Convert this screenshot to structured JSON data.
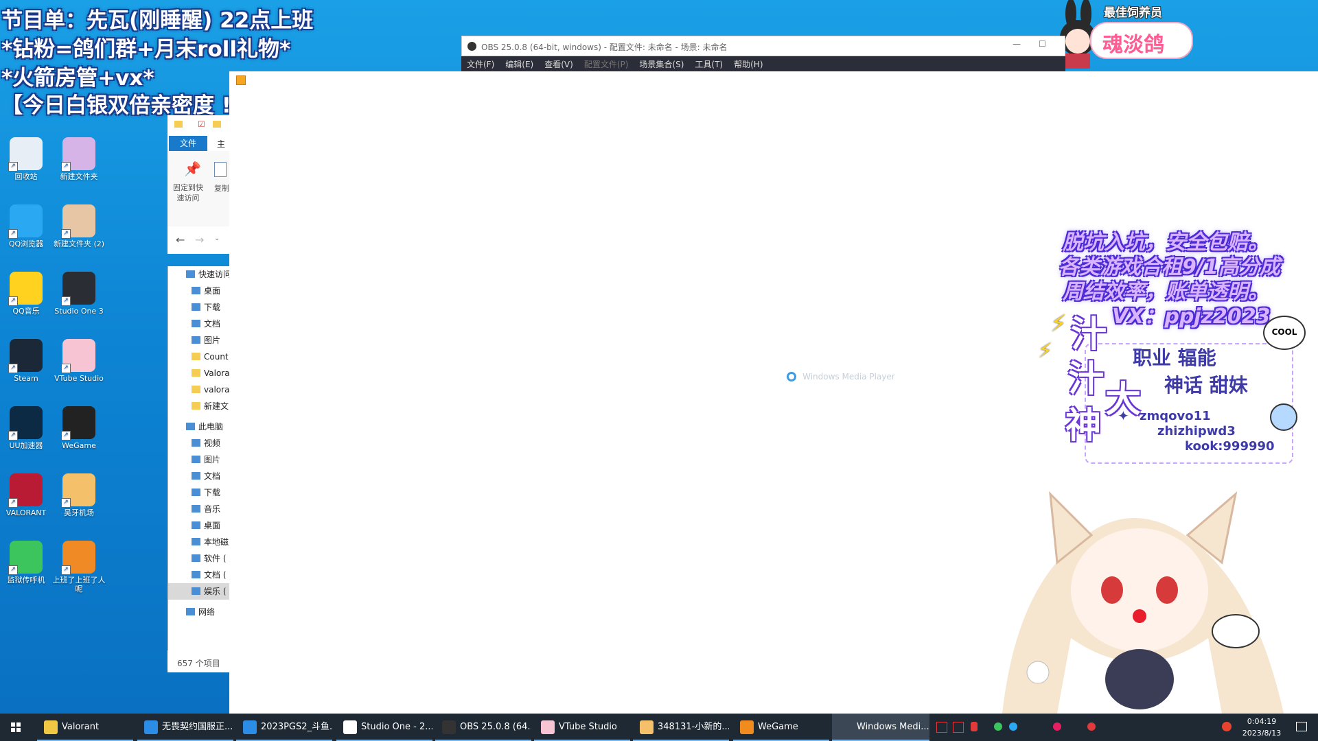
{
  "overlay": {
    "line1": "节目单：先瓦(刚睡醒) 22点上班",
    "line2": "*钻粉=鸽们群+月末roll礼物*",
    "line3": "*火箭房管+vx*",
    "line4": "【今日白银双倍亲密度 !!! 】"
  },
  "badge": {
    "title": "最佳饲养员",
    "name": "魂淡鸽"
  },
  "desktop_icons": [
    {
      "label": "回收站",
      "color": "#e8eef5"
    },
    {
      "label": "新建文件夹",
      "color": "#d6b4e8"
    },
    {
      "label": "QQ浏览器",
      "color": "#2aa8f2"
    },
    {
      "label": "新建文件夹 (2)",
      "color": "#e7c6a5"
    },
    {
      "label": "QQ音乐",
      "color": "#ffd21f"
    },
    {
      "label": "Studio One 3",
      "color": "#2a2d33"
    },
    {
      "label": "Steam",
      "color": "#1b2838"
    },
    {
      "label": "VTube Studio",
      "color": "#f7c4d4"
    },
    {
      "label": "UU加速器",
      "color": "#0d2a44"
    },
    {
      "label": "WeGame",
      "color": "#222"
    },
    {
      "label": "VALORANT",
      "color": "#b81b33"
    },
    {
      "label": "吴牙机场",
      "color": "#f4c06a"
    },
    {
      "label": "监狱传呼机",
      "color": "#3cc55d"
    },
    {
      "label": "上班了上班了人呢",
      "color": "#f08a24"
    }
  ],
  "obs": {
    "title": "OBS 25.0.8 (64-bit, windows) - 配置文件: 未命名 - 场景: 未命名",
    "menu": [
      "文件(F)",
      "编辑(E)",
      "查看(V)",
      "配置文件(P)",
      "场景集合(S)",
      "工具(T)",
      "帮助(H)"
    ]
  },
  "explorer": {
    "tab_file": "文件",
    "tab_home": "主页",
    "pin_label": "固定到快速访问",
    "copy_label": "复制",
    "nav_items": [
      "快速访问",
      "桌面",
      "下载",
      "文档",
      "图片",
      "Count",
      "Valora",
      "valora",
      "新建文",
      "此电脑",
      "视频",
      "图片",
      "文档",
      "下载",
      "音乐",
      "桌面",
      "本地磁",
      "软件 (",
      "文档 (",
      "娱乐 (",
      "网络"
    ],
    "item_count": "657 个项目"
  },
  "wmp": {
    "loading_text": "Windows Media Player"
  },
  "promo": {
    "line1": "脱坑入坑，安全包赔。",
    "line2": "各类游戏合租9/1高分成",
    "line3": "周结效率，账单透明。",
    "line4": "VX：ppjz2023",
    "chars": [
      "汁",
      "汁",
      "大",
      "神"
    ],
    "role1": "职业 辐能",
    "role2": "神话 甜妹",
    "cool": "COOL",
    "id1": "zmqovo11",
    "id2": "zhizhipwd3",
    "id3": "kook:999990"
  },
  "taskbar": {
    "items": [
      {
        "label": "Valorant",
        "color": "#f2c744"
      },
      {
        "label": "无畏契约国服正...",
        "color": "#2b8de6"
      },
      {
        "label": "2023PGS2_斗鱼...",
        "color": "#2b8de6"
      },
      {
        "label": "Studio One - 2...",
        "color": "#ffffff"
      },
      {
        "label": "OBS 25.0.8 (64...",
        "color": "#333"
      },
      {
        "label": "VTube Studio",
        "color": "#f7c4d4"
      },
      {
        "label": "348131-小新的...",
        "color": "#f4c06a"
      },
      {
        "label": "WeGame",
        "color": "#f28b1e"
      },
      {
        "label": "Windows Medi...",
        "color": "#4a5664"
      }
    ],
    "time": "0:04:19",
    "date": "2023/8/13"
  }
}
